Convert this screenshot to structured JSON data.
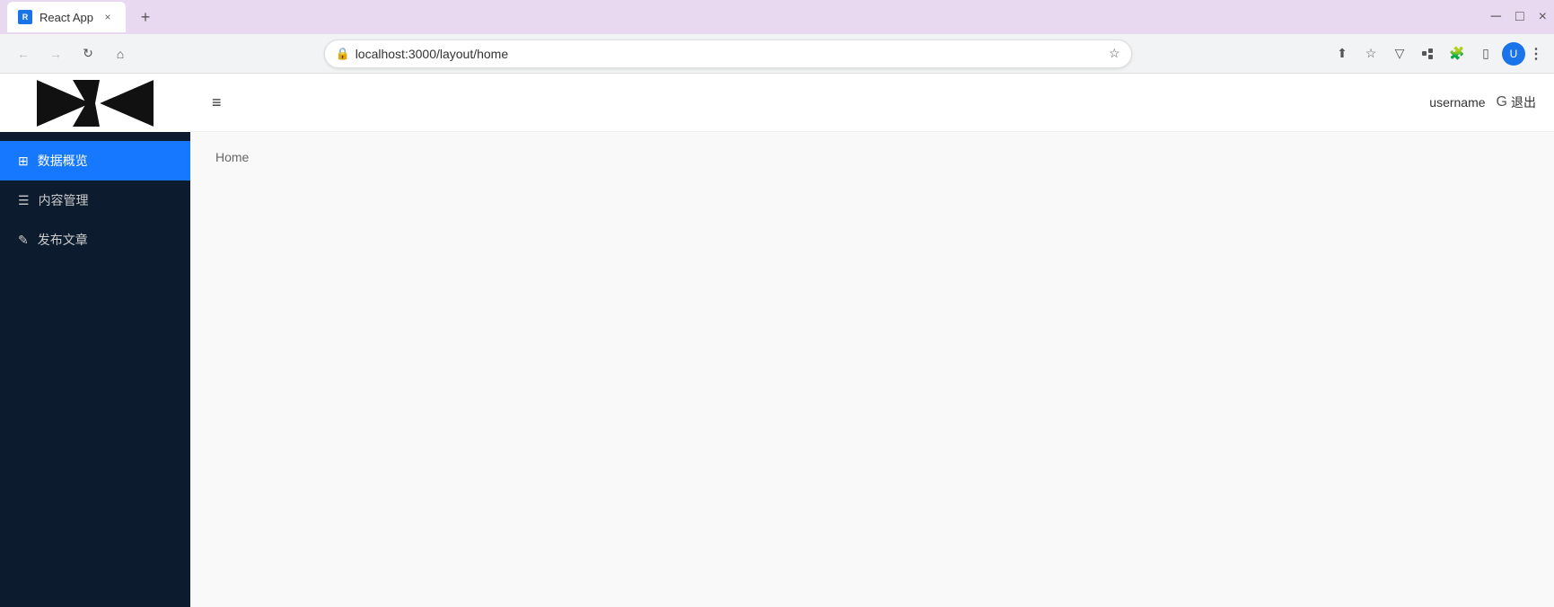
{
  "browser": {
    "tab_title": "React App",
    "tab_favicon": "R",
    "close_label": "×",
    "new_tab_label": "+",
    "window_controls": {
      "minimize": "─",
      "maximize": "□",
      "close": "×"
    },
    "address": "localhost:3000/layout/home",
    "nav": {
      "back": "←",
      "forward": "→",
      "reload": "↻",
      "home": "⌂"
    }
  },
  "sidebar": {
    "items": [
      {
        "id": "dashboard",
        "label": "数据概览",
        "icon": "⊞",
        "active": true
      },
      {
        "id": "content",
        "label": "内容管理",
        "icon": "☰",
        "active": false
      },
      {
        "id": "publish",
        "label": "发布文章",
        "icon": "✎",
        "active": false
      }
    ]
  },
  "header": {
    "menu_toggle_icon": "≡",
    "username": "username",
    "logout_label": "退出",
    "logout_icon": "G"
  },
  "page": {
    "breadcrumb": "Home"
  }
}
